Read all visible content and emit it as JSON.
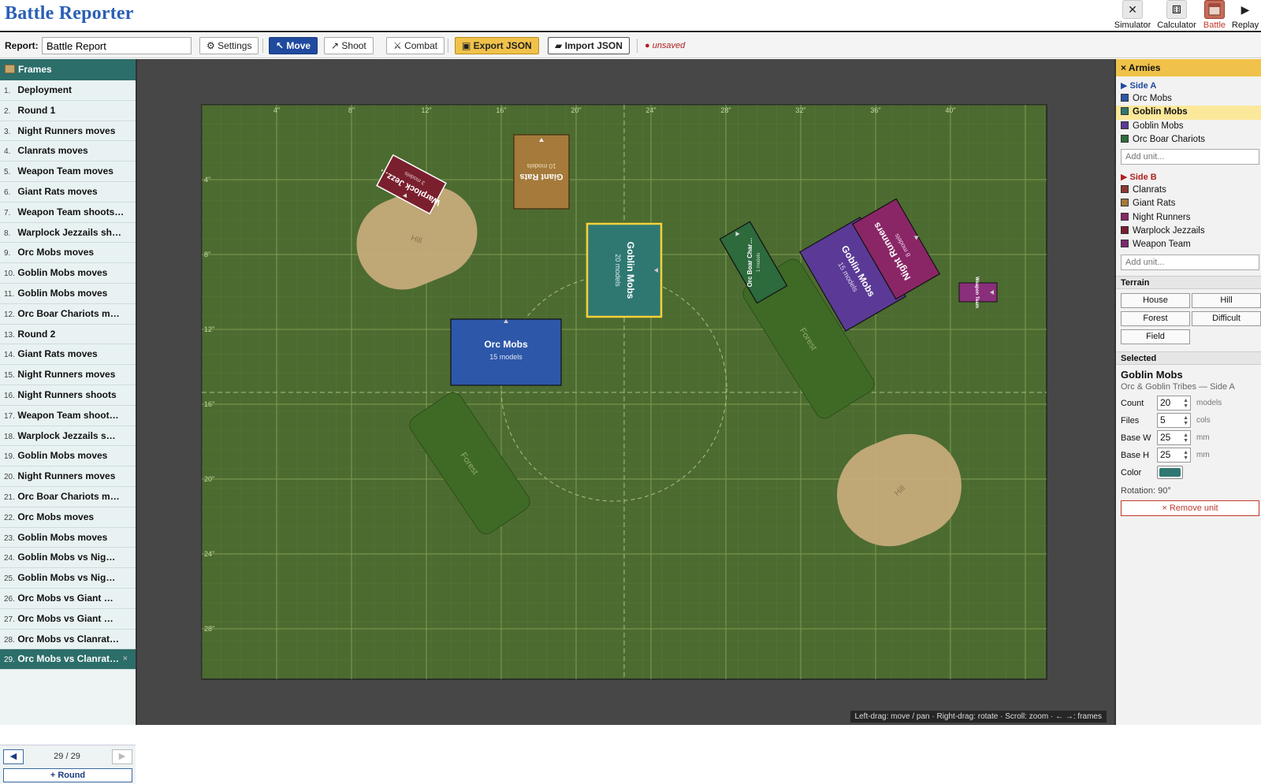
{
  "app": {
    "title": "Battle Reporter",
    "modes": [
      {
        "label": "Simulator",
        "icon": "close-icon",
        "glyph": "✕",
        "active": false
      },
      {
        "label": "Calculator",
        "icon": "dice-icon",
        "glyph": "⚅",
        "active": false
      },
      {
        "label": "Battle",
        "icon": "battle-icon",
        "glyph": "",
        "active": true
      },
      {
        "label": "Replay",
        "icon": "play-icon",
        "glyph": "▶",
        "active": false
      }
    ]
  },
  "toolbar": {
    "report_label": "Report:",
    "report_value": "Battle Report",
    "settings_label": "⚙ Settings",
    "move_label": "↖ Move",
    "shoot_label": "↗ Shoot",
    "combat_label": "⚔ Combat",
    "export_label": "Export JSON",
    "import_label": "Import JSON",
    "status": "● unsaved"
  },
  "frames": {
    "title": "Frames",
    "items": [
      {
        "num": "1.",
        "label": "Deployment"
      },
      {
        "num": "2.",
        "label": "Round 1"
      },
      {
        "num": "3.",
        "label": "Night Runners moves"
      },
      {
        "num": "4.",
        "label": "Clanrats moves"
      },
      {
        "num": "5.",
        "label": "Weapon Team moves"
      },
      {
        "num": "6.",
        "label": "Giant Rats moves"
      },
      {
        "num": "7.",
        "label": "Weapon Team shoots…"
      },
      {
        "num": "8.",
        "label": "Warplock Jezzails sh…"
      },
      {
        "num": "9.",
        "label": "Orc Mobs moves"
      },
      {
        "num": "10.",
        "label": "Goblin Mobs moves"
      },
      {
        "num": "11.",
        "label": "Goblin Mobs moves"
      },
      {
        "num": "12.",
        "label": "Orc Boar Chariots m…"
      },
      {
        "num": "13.",
        "label": "Round 2"
      },
      {
        "num": "14.",
        "label": "Giant Rats moves"
      },
      {
        "num": "15.",
        "label": "Night Runners moves"
      },
      {
        "num": "16.",
        "label": "Night Runners shoots"
      },
      {
        "num": "17.",
        "label": "Weapon Team shoot…"
      },
      {
        "num": "18.",
        "label": "Warplock Jezzails s…"
      },
      {
        "num": "19.",
        "label": "Goblin Mobs moves"
      },
      {
        "num": "20.",
        "label": "Night Runners moves"
      },
      {
        "num": "21.",
        "label": "Orc Boar Chariots m…"
      },
      {
        "num": "22.",
        "label": "Orc Mobs moves"
      },
      {
        "num": "23.",
        "label": "Goblin Mobs moves"
      },
      {
        "num": "24.",
        "label": "Goblin Mobs vs Nig…"
      },
      {
        "num": "25.",
        "label": "Goblin Mobs vs Nig…"
      },
      {
        "num": "26.",
        "label": "Orc Mobs vs Giant …"
      },
      {
        "num": "27.",
        "label": "Orc Mobs vs Giant …"
      },
      {
        "num": "28.",
        "label": "Orc Mobs vs Clanrat…"
      },
      {
        "num": "29.",
        "label": "Orc Mobs vs Clanrat…",
        "active": true
      }
    ],
    "close_glyph": "×",
    "prev_glyph": "◀",
    "next_glyph": "▶",
    "counter": "29 / 29",
    "add_round": "+ Round"
  },
  "board": {
    "ruler_top": [
      "4\"",
      "8\"",
      "12\"",
      "16\"",
      "20\"",
      "24\"",
      "28\"",
      "32\"",
      "36\"",
      "40\""
    ],
    "ruler_left": [
      "4\"",
      "8\"",
      "12\"",
      "16\"",
      "20\"",
      "24\"",
      "28\""
    ],
    "terrain": [
      {
        "label": "Hill",
        "kind": "hill"
      },
      {
        "label": "Forest",
        "kind": "forest"
      },
      {
        "label": "Forest",
        "kind": "forest"
      },
      {
        "label": "Hill",
        "kind": "hill"
      }
    ],
    "units": [
      {
        "name": "Warplock Jezz…",
        "models": "3 models",
        "color": "#7a1f2e"
      },
      {
        "name": "Giant Rats",
        "models": "10 models",
        "color": "#a57a3a"
      },
      {
        "name": "Goblin Mobs",
        "models": "20 models",
        "color": "#2f7872"
      },
      {
        "name": "Orc Mobs",
        "models": "15 models",
        "color": "#2d57a8"
      },
      {
        "name": "Orc Boar Char…",
        "models": "1 models",
        "color": "#2d6a3c"
      },
      {
        "name": "Goblin Mobs",
        "models": "15 models",
        "color": "#5a3a96"
      },
      {
        "name": "Night Runners",
        "models": "8 models",
        "color": "#8a2666"
      },
      {
        "name": "Weapon Team",
        "models": "",
        "color": "#8a2f7a"
      }
    ],
    "hint": "Left-drag: move / pan · Right-drag: rotate · Scroll: zoom · ← →: frames"
  },
  "armies": {
    "title": "× Armies",
    "side_a": {
      "label": "▶ Side A",
      "units": [
        {
          "name": "Orc Mobs",
          "color": "#2d57a8"
        },
        {
          "name": "Goblin Mobs",
          "color": "#2f7872",
          "active": true
        },
        {
          "name": "Goblin Mobs",
          "color": "#5a3a96"
        },
        {
          "name": "Orc Boar Chariots",
          "color": "#2d6a3c"
        }
      ],
      "add_placeholder": "Add unit..."
    },
    "side_b": {
      "label": "▶ Side B",
      "units": [
        {
          "name": "Clanrats",
          "color": "#8b3a2e"
        },
        {
          "name": "Giant Rats",
          "color": "#a57a3a"
        },
        {
          "name": "Night Runners",
          "color": "#8a2666"
        },
        {
          "name": "Warplock Jezzails",
          "color": "#7a1f2e"
        },
        {
          "name": "Weapon Team",
          "color": "#7a2a6e"
        }
      ],
      "add_placeholder": "Add unit..."
    }
  },
  "terrain_panel": {
    "title": "Terrain",
    "buttons": [
      "House",
      "Hill",
      "Forest",
      "Difficult",
      "Field"
    ]
  },
  "selected": {
    "title": "Selected",
    "name": "Goblin Mobs",
    "subtitle": "Orc & Goblin Tribes — Side A",
    "count_label": "Count",
    "count": "20",
    "count_unit": "models",
    "files_label": "Files",
    "files": "5",
    "files_unit": "cols",
    "basew_label": "Base W",
    "basew": "25",
    "basew_unit": "mm",
    "baseh_label": "Base H",
    "baseh": "25",
    "baseh_unit": "mm",
    "color_label": "Color",
    "color": "#2f7872",
    "rotation": "Rotation: 90°",
    "remove_label": "× Remove unit"
  },
  "colors": {
    "board": "#4c6b30",
    "canvas_bg": "#474747",
    "accent_teal": "#2c6e6a",
    "accent_yellow": "#f0c24a",
    "title_blue": "#2a5fb5"
  }
}
